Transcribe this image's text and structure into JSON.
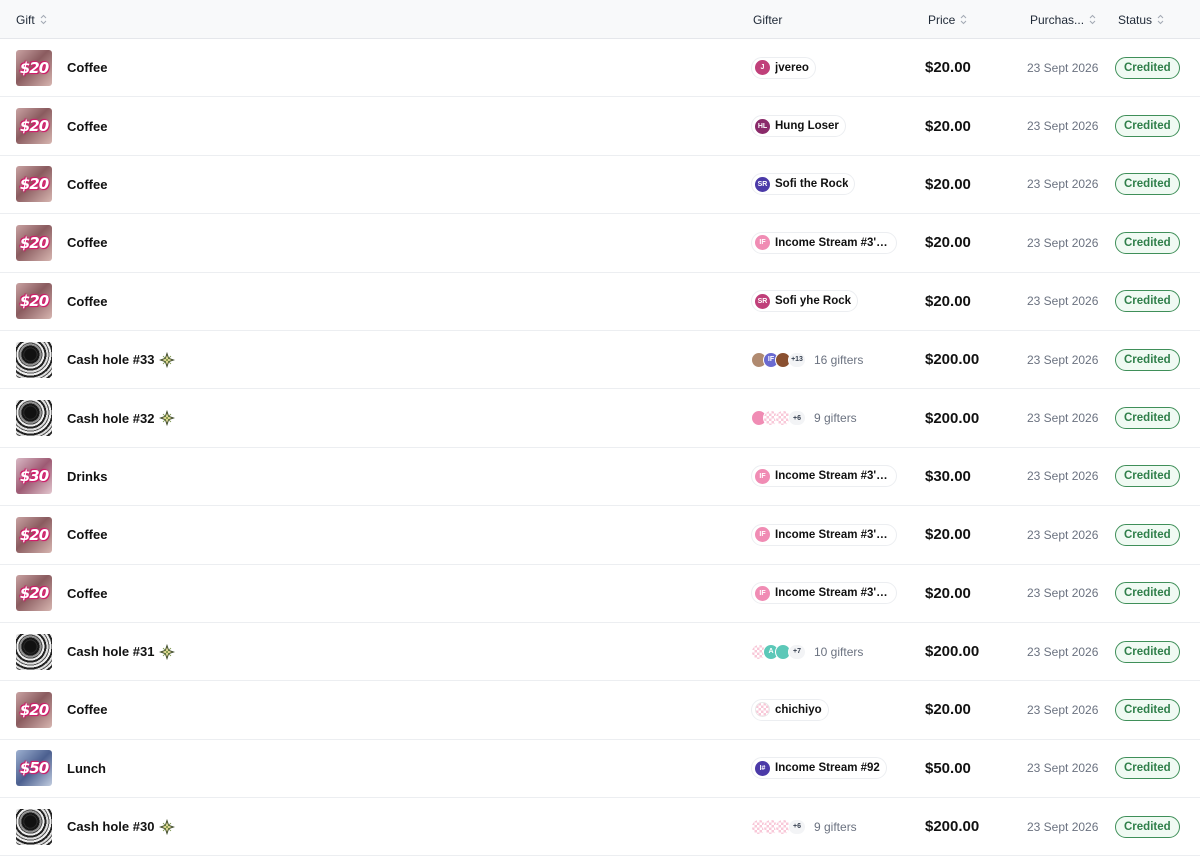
{
  "columns": {
    "gift": "Gift",
    "gifter": "Gifter",
    "price": "Price",
    "purchased": "Purchas...",
    "status": "Status"
  },
  "colors": {
    "credited_border": "#3f8f59",
    "credited_text": "#2f7f4a",
    "header_bg": "#f8f9fa"
  },
  "rows": [
    {
      "thumb_type": "money",
      "thumb_text": "$20",
      "name": "Coffee",
      "sparkle": false,
      "gifter_type": "single",
      "gifter": {
        "initials": "J",
        "name": "jvereo",
        "color": "#c0407a"
      },
      "price": "$20.00",
      "date": "23 Sept 2026",
      "status": "Credited"
    },
    {
      "thumb_type": "money",
      "thumb_text": "$20",
      "name": "Coffee",
      "sparkle": false,
      "gifter_type": "single",
      "gifter": {
        "initials": "HL",
        "name": "Hung Loser",
        "color": "#8a2a6a"
      },
      "price": "$20.00",
      "date": "23 Sept 2026",
      "status": "Credited"
    },
    {
      "thumb_type": "money",
      "thumb_text": "$20",
      "name": "Coffee",
      "sparkle": false,
      "gifter_type": "single",
      "gifter": {
        "initials": "SR",
        "name": "Sofi the Rock",
        "color": "#4b3aa8"
      },
      "price": "$20.00",
      "date": "23 Sept 2026",
      "status": "Credited"
    },
    {
      "thumb_type": "money",
      "thumb_text": "$20",
      "name": "Coffee",
      "sparkle": false,
      "gifter_type": "single",
      "gifter": {
        "initials": "IF",
        "name": "Income Stream #3's...",
        "color": "#f08cb4"
      },
      "price": "$20.00",
      "date": "23 Sept 2026",
      "status": "Credited"
    },
    {
      "thumb_type": "money",
      "thumb_text": "$20",
      "name": "Coffee",
      "sparkle": false,
      "gifter_type": "single",
      "gifter": {
        "initials": "SR",
        "name": "Sofi yhe Rock",
        "color": "#c0407a"
      },
      "price": "$20.00",
      "date": "23 Sept 2026",
      "status": "Credited"
    },
    {
      "thumb_type": "hole",
      "thumb_text": "",
      "name": "Cash hole #33",
      "sparkle": true,
      "gifter_type": "group",
      "avatars": [
        {
          "initials": "",
          "color": "#b08a70"
        },
        {
          "initials": "IF",
          "color": "#6a6ad0"
        },
        {
          "initials": "",
          "color": "#8a5030"
        }
      ],
      "more": "+13",
      "count_label": "16 gifters",
      "price": "$200.00",
      "date": "23 Sept 2026",
      "status": "Credited"
    },
    {
      "thumb_type": "hole",
      "thumb_text": "",
      "name": "Cash hole #32",
      "sparkle": true,
      "gifter_type": "group",
      "avatars": [
        {
          "initials": "",
          "color": "#f08cb4"
        },
        {
          "initials": "",
          "color": "#f4d0dc"
        },
        {
          "initials": "",
          "color": "#f4d0dc"
        }
      ],
      "more": "+6",
      "count_label": "9 gifters",
      "price": "$200.00",
      "date": "23 Sept 2026",
      "status": "Credited"
    },
    {
      "thumb_type": "money",
      "thumb_text": "$30",
      "name": "Drinks",
      "sparkle": false,
      "gifter_type": "single",
      "gifter": {
        "initials": "IF",
        "name": "Income Stream #3's...",
        "color": "#f08cb4"
      },
      "price": "$30.00",
      "date": "23 Sept 2026",
      "status": "Credited"
    },
    {
      "thumb_type": "money",
      "thumb_text": "$20",
      "name": "Coffee",
      "sparkle": false,
      "gifter_type": "single",
      "gifter": {
        "initials": "IF",
        "name": "Income Stream #3's...",
        "color": "#f08cb4"
      },
      "price": "$20.00",
      "date": "23 Sept 2026",
      "status": "Credited"
    },
    {
      "thumb_type": "money",
      "thumb_text": "$20",
      "name": "Coffee",
      "sparkle": false,
      "gifter_type": "single",
      "gifter": {
        "initials": "IF",
        "name": "Income Stream #3's...",
        "color": "#f08cb4"
      },
      "price": "$20.00",
      "date": "23 Sept 2026",
      "status": "Credited"
    },
    {
      "thumb_type": "hole",
      "thumb_text": "",
      "name": "Cash hole #31",
      "sparkle": true,
      "gifter_type": "group",
      "avatars": [
        {
          "initials": "",
          "color": "#f4d0dc"
        },
        {
          "initials": "A",
          "color": "#5cc8b8"
        },
        {
          "initials": "",
          "color": "#5cc8b8"
        }
      ],
      "more": "+7",
      "count_label": "10 gifters",
      "price": "$200.00",
      "date": "23 Sept 2026",
      "status": "Credited"
    },
    {
      "thumb_type": "money",
      "thumb_text": "$20",
      "name": "Coffee",
      "sparkle": false,
      "gifter_type": "single",
      "gifter": {
        "initials": "",
        "name": "chichiyo",
        "color": "#f4d0dc"
      },
      "price": "$20.00",
      "date": "23 Sept 2026",
      "status": "Credited"
    },
    {
      "thumb_type": "money",
      "thumb_text": "$50",
      "name": "Lunch",
      "sparkle": false,
      "gifter_type": "single",
      "gifter": {
        "initials": "I#",
        "name": "Income Stream #92",
        "color": "#4b3aa8"
      },
      "price": "$50.00",
      "date": "23 Sept 2026",
      "status": "Credited"
    },
    {
      "thumb_type": "hole",
      "thumb_text": "",
      "name": "Cash hole #30",
      "sparkle": true,
      "gifter_type": "group",
      "avatars": [
        {
          "initials": "",
          "color": "#f4d0dc"
        },
        {
          "initials": "",
          "color": "#f4d0dc"
        },
        {
          "initials": "",
          "color": "#f4d0dc"
        }
      ],
      "more": "+6",
      "count_label": "9 gifters",
      "price": "$200.00",
      "date": "23 Sept 2026",
      "status": "Credited"
    }
  ]
}
